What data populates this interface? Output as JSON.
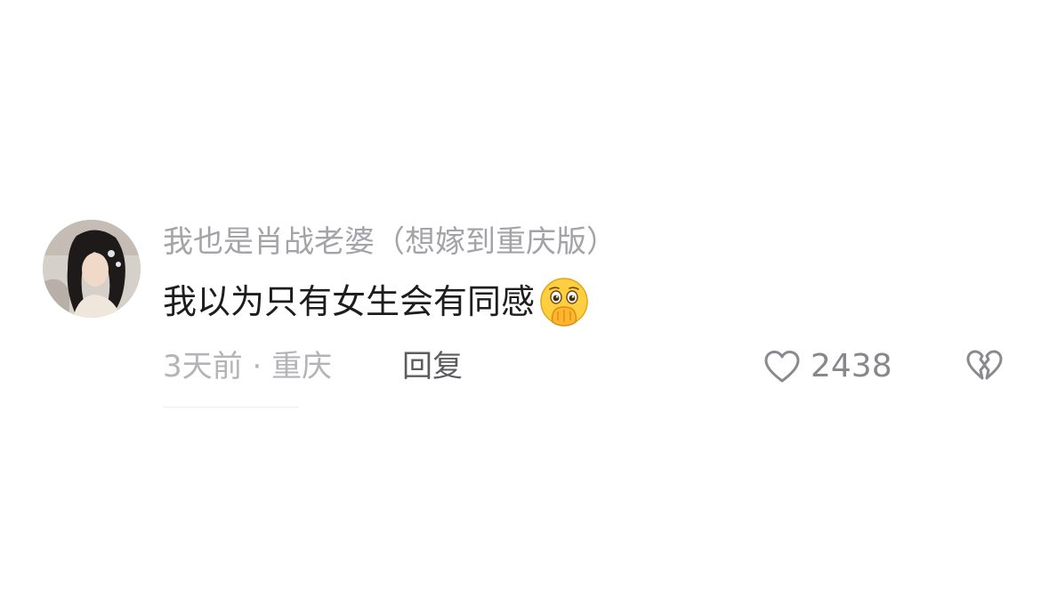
{
  "comment": {
    "username": "我也是肖战老婆（想嫁到重庆版）",
    "text": "我以为只有女生会有同感",
    "emoji": "hand-over-mouth-emoji",
    "time": "3天前",
    "separator": "·",
    "location": "重庆",
    "reply_label": "回复",
    "like_count": "2438"
  },
  "icons": {
    "like": "heart-outline-icon",
    "dislike": "broken-heart-icon"
  },
  "colors": {
    "username": "#a3a3a8",
    "text": "#1d1d1f",
    "meta": "#b4b4b8",
    "reply": "#5c5c60",
    "icon": "#8a8a8e"
  }
}
